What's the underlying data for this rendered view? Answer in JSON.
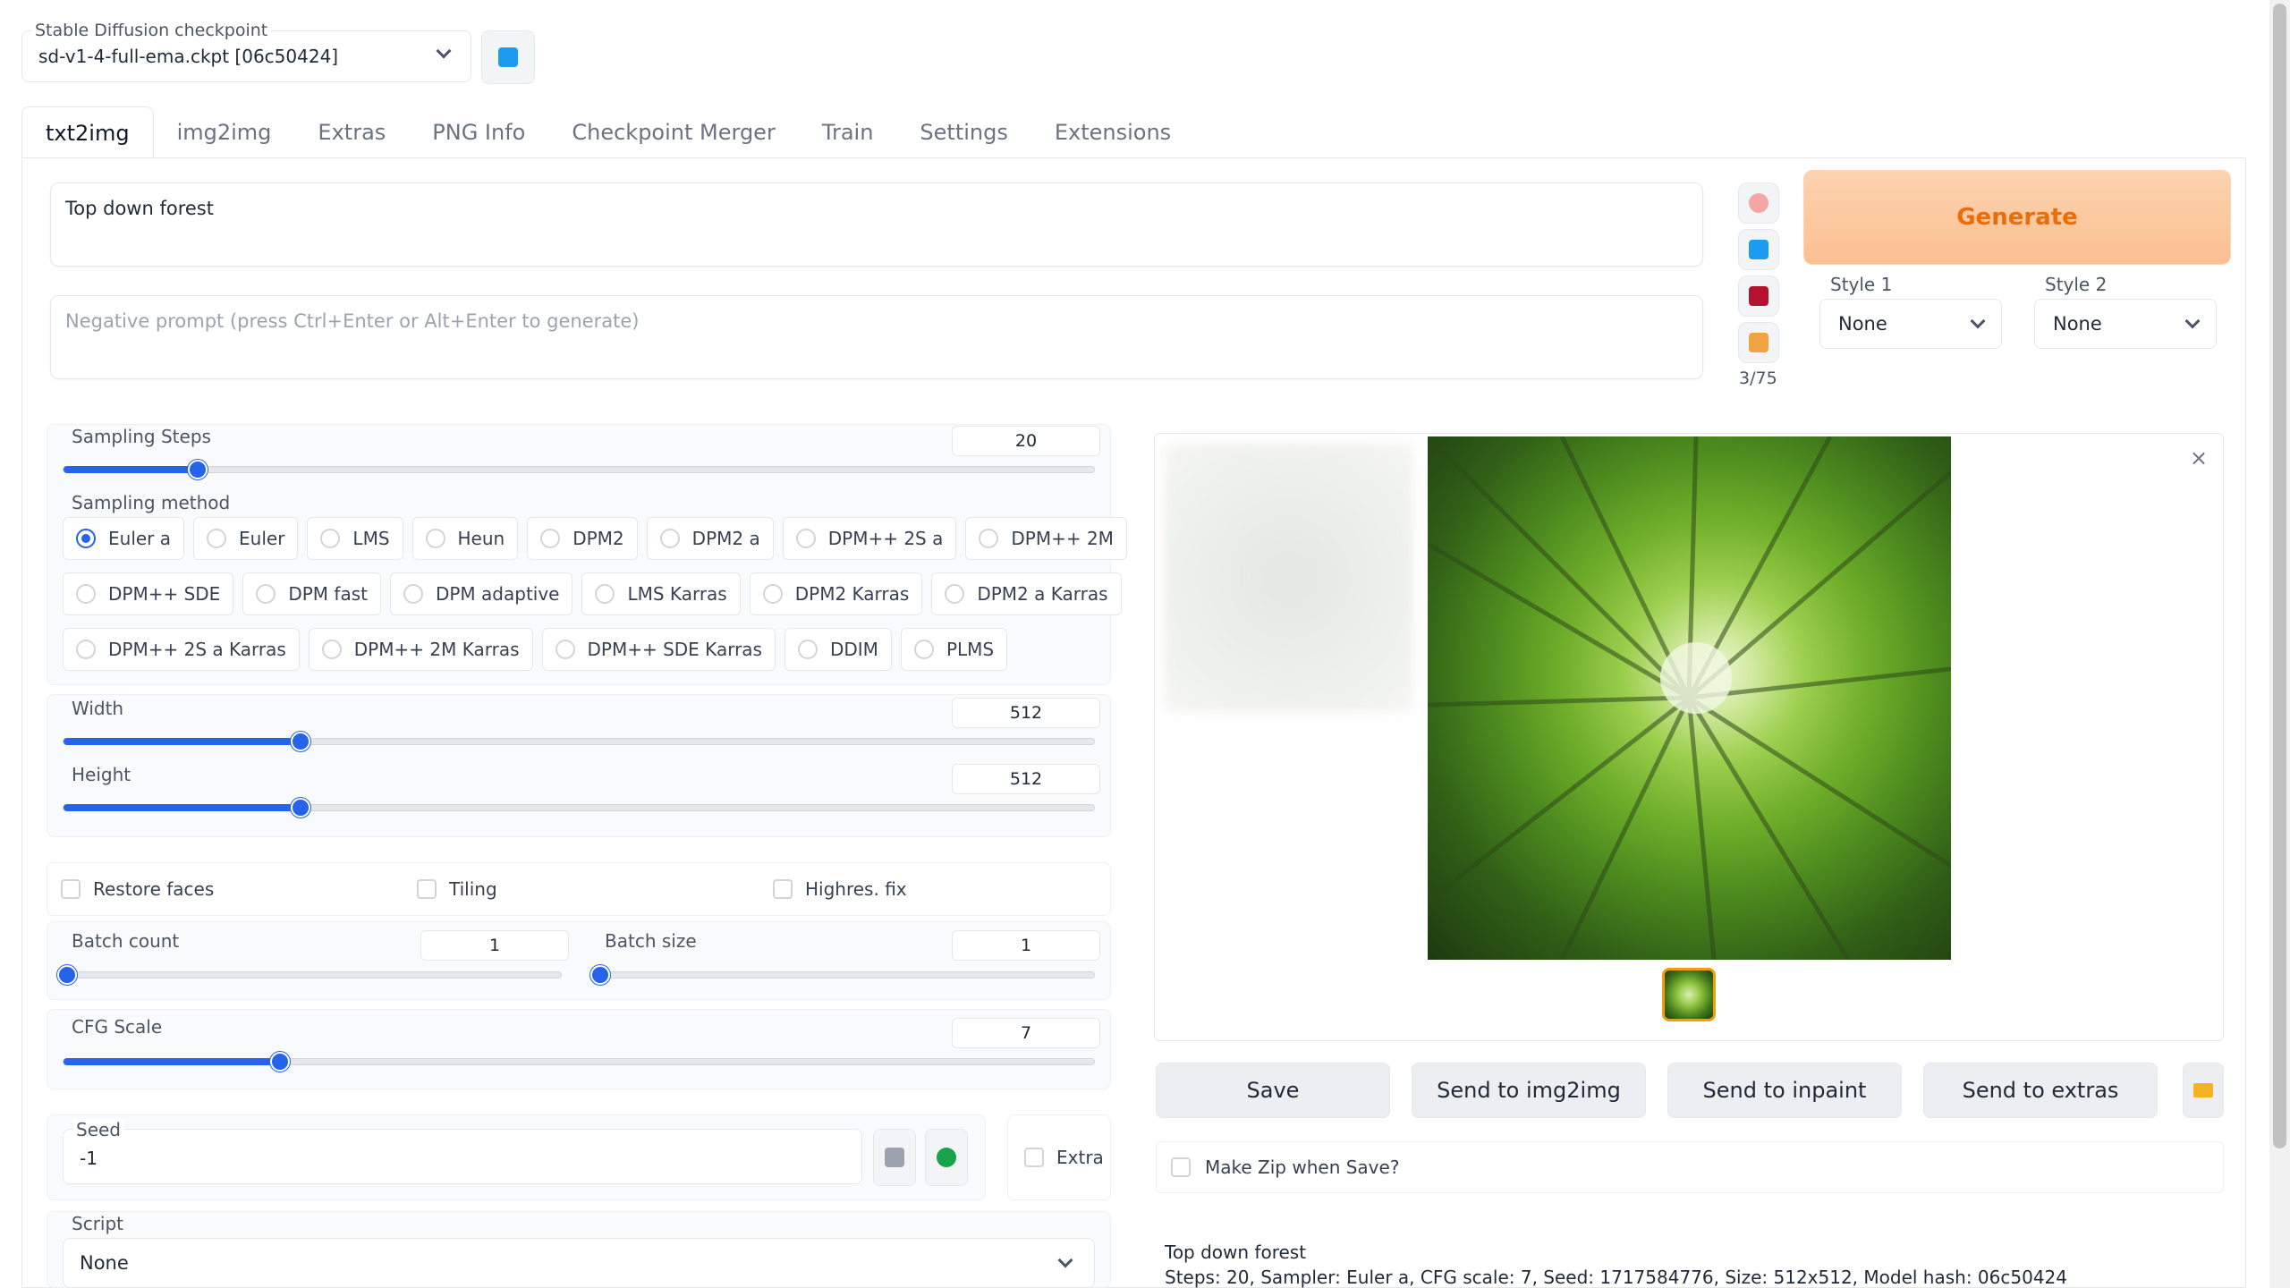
{
  "checkpoint": {
    "label": "Stable Diffusion checkpoint",
    "value": "sd-v1-4-full-ema.ckpt [06c50424]"
  },
  "tabs": [
    "txt2img",
    "img2img",
    "Extras",
    "PNG Info",
    "Checkpoint Merger",
    "Train",
    "Settings",
    "Extensions"
  ],
  "prompt": {
    "positive": "Top down forest",
    "negative_placeholder": "Negative prompt (press Ctrl+Enter or Alt+Enter to generate)",
    "token_count": "3/75"
  },
  "generate_label": "Generate",
  "styles": {
    "style1": {
      "label": "Style 1",
      "value": "None"
    },
    "style2": {
      "label": "Style 2",
      "value": "None"
    }
  },
  "sampling_steps": {
    "label": "Sampling Steps",
    "value": "20",
    "fraction": 0.13
  },
  "sampling_method": {
    "label": "Sampling method",
    "selected": "Euler a",
    "row1": [
      "Euler a",
      "Euler",
      "LMS",
      "Heun",
      "DPM2",
      "DPM2 a",
      "DPM++ 2S a",
      "DPM++ 2M"
    ],
    "row2": [
      "DPM++ SDE",
      "DPM fast",
      "DPM adaptive",
      "LMS Karras",
      "DPM2 Karras",
      "DPM2 a Karras"
    ],
    "row3": [
      "DPM++ 2S a Karras",
      "DPM++ 2M Karras",
      "DPM++ SDE Karras",
      "DDIM",
      "PLMS"
    ]
  },
  "width": {
    "label": "Width",
    "value": "512",
    "fraction": 0.23
  },
  "height": {
    "label": "Height",
    "value": "512",
    "fraction": 0.23
  },
  "options": {
    "restore_faces": "Restore faces",
    "tiling": "Tiling",
    "highres_fix": "Highres. fix"
  },
  "batch_count": {
    "label": "Batch count",
    "value": "1",
    "fraction": 0.0
  },
  "batch_size": {
    "label": "Batch size",
    "value": "1",
    "fraction": 0.0
  },
  "cfg_scale": {
    "label": "CFG Scale",
    "value": "7",
    "fraction": 0.21
  },
  "seed": {
    "label": "Seed",
    "value": "-1",
    "extra_label": "Extra"
  },
  "script": {
    "label": "Script",
    "value": "None"
  },
  "actions": {
    "save": "Save",
    "send_img2img": "Send to img2img",
    "send_inpaint": "Send to inpaint",
    "send_extras": "Send to extras"
  },
  "make_zip_label": "Make Zip when Save?",
  "info": {
    "line1": "Top down forest",
    "line2": "Steps: 20, Sampler: Euler a, CFG scale: 7, Seed: 1717584776, Size: 512x512, Model hash: 06c50424"
  },
  "colors": {
    "accent": "#2563eb",
    "generate_bg": "#fbbf91",
    "generate_text": "#ea6c0a"
  }
}
